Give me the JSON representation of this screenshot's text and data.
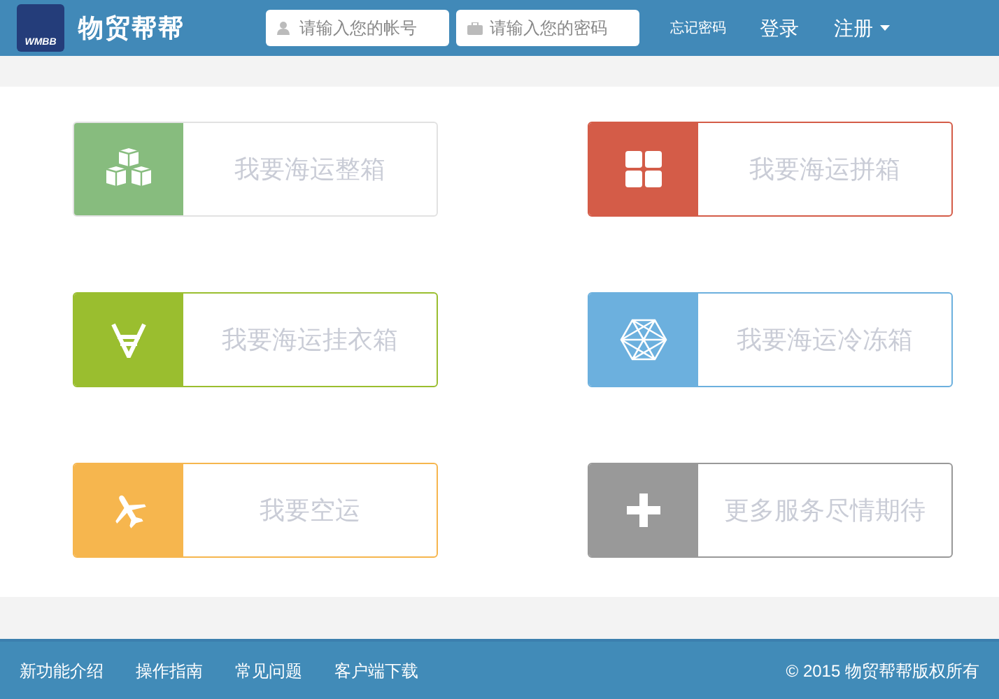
{
  "header": {
    "logo_badge": "WMBB",
    "brand": "物贸帮帮",
    "account_field": {
      "placeholder": "请输入您的帐号"
    },
    "password_field": {
      "placeholder": "请输入您的密码"
    },
    "links": [
      "忘记密码",
      "登录"
    ],
    "register": "注册"
  },
  "services": [
    {
      "label": "我要海运整箱",
      "kind": "cubes",
      "color": "#87bc7e"
    },
    {
      "label": "我要海运拼箱",
      "kind": "grid",
      "color": "#d45c48"
    },
    {
      "label": "我要海运挂衣箱",
      "kind": "hanger",
      "color": "#9abe2f"
    },
    {
      "label": "我要海运冷冻箱",
      "kind": "crystal",
      "color": "#6cb0de"
    },
    {
      "label": "我要空运",
      "kind": "plane",
      "color": "#f6b64e"
    },
    {
      "label": "更多服务尽情期待",
      "kind": "plus",
      "color": "#999999"
    }
  ],
  "footer": {
    "links": [
      "新功能介绍",
      "操作指南",
      "常见问题",
      "客户端下载"
    ],
    "copyright": "© 2015 物贸帮帮版权所有"
  }
}
